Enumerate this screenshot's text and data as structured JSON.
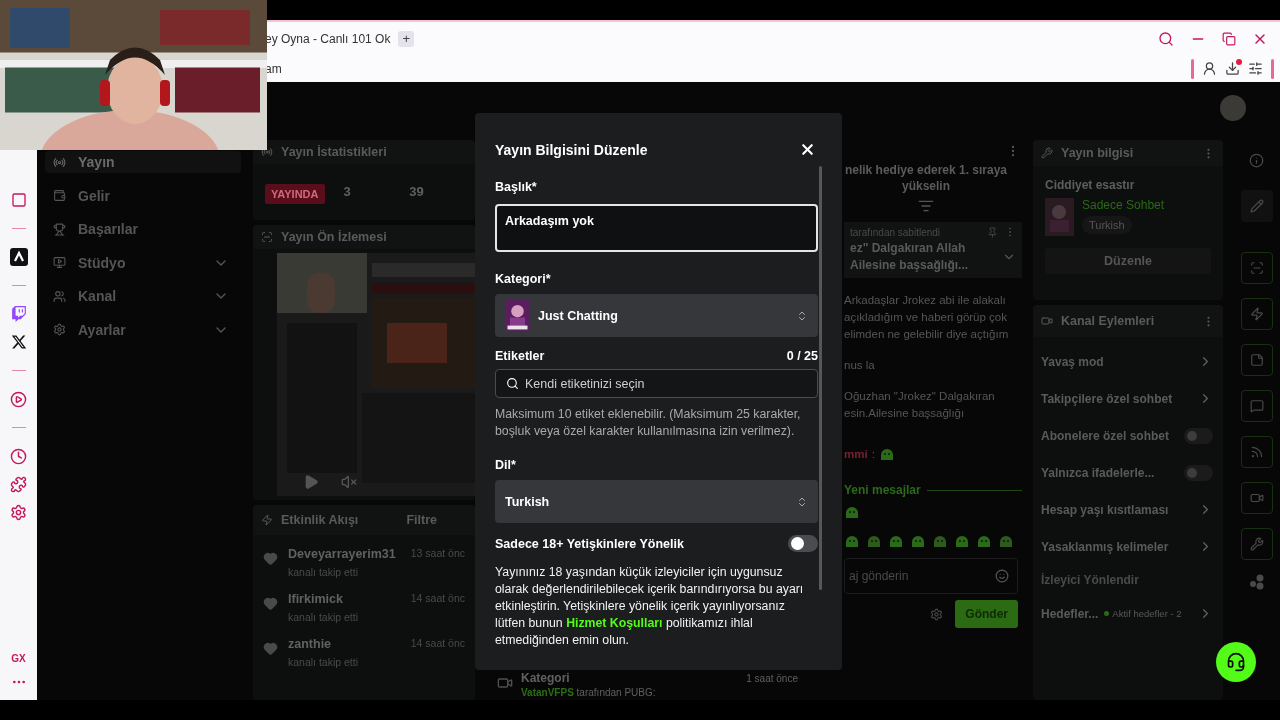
{
  "browser": {
    "tab_title": "ey Oyna - Canlı 101 Ok",
    "new_tab": "+",
    "address": "am",
    "download_alert": true
  },
  "opera_sidebar": {
    "badge": "GX"
  },
  "nav": {
    "items": [
      {
        "label": "Yayın",
        "selected": true,
        "expandable": false
      },
      {
        "label": "Gelir",
        "selected": false,
        "expandable": false
      },
      {
        "label": "Başarılar",
        "selected": false,
        "expandable": false
      },
      {
        "label": "Stüdyo",
        "selected": false,
        "expandable": true
      },
      {
        "label": "Kanal",
        "selected": false,
        "expandable": true
      },
      {
        "label": "Ayarlar",
        "selected": false,
        "expandable": true
      }
    ]
  },
  "stats": {
    "title": "Yayın İstatistikleri",
    "status": "YAYINDA",
    "values": [
      "3",
      "39"
    ]
  },
  "preview": {
    "title": "Yayın Ön İzlemesi"
  },
  "activity": {
    "title": "Etkinlik Akışı",
    "filter": "Filtre",
    "items": [
      {
        "user": "Deveyarrayerim31",
        "action": "kanalı takip etti",
        "time": "13 saat önc"
      },
      {
        "user": "Ifirkimick",
        "action": "kanalı takip etti",
        "time": "14 saat önc"
      },
      {
        "user": "zanthie",
        "action": "kanalı takip etti",
        "time": "14 saat önc"
      }
    ]
  },
  "feed_item": {
    "title": "Kategori",
    "user": "VatanVFPS",
    "text": "tarafından PUBG:",
    "time": "1 saat önce"
  },
  "chat": {
    "banner": [
      "nelik hediye ederek 1. sıraya",
      "yükselin"
    ],
    "pinned": {
      "by": "tarafından sabitlendi",
      "lines": [
        "ez\" Dalgakıran Allah",
        "Ailesine başsağlığı..."
      ]
    },
    "messages": [
      {
        "kind": "text",
        "lines": [
          "Arkadaşlar Jrokez abi ile alakalı",
          "açıkladığım ve haberi görüp çok",
          "elimden ne gelebilir diye açtığım"
        ]
      },
      {
        "kind": "text",
        "lines": [
          "nus la"
        ]
      },
      {
        "kind": "text",
        "lines": [
          "Oğuzhan \"Jrokez\" Dalgakıran",
          "esin.Ailesine başsağlığı"
        ]
      },
      {
        "kind": "emote",
        "user": "mmi",
        "separator": ":"
      }
    ],
    "new_messages": "Yeni mesajlar",
    "input_placeholder": "aj gönderin",
    "send": "Gönder"
  },
  "stream_info": {
    "title": "Yayın bilgisi",
    "stream_title": "Ciddiyet esastır",
    "category": "Sadece Sohbet",
    "language": "Turkish",
    "edit": "Düzenle"
  },
  "channel_actions": {
    "title": "Kanal Eylemleri",
    "items": [
      {
        "kind": "link",
        "label": "Yavaş mod"
      },
      {
        "kind": "link",
        "label": "Takipçilere özel sohbet"
      },
      {
        "kind": "toggle",
        "label": "Abonelere özel sohbet",
        "on": false
      },
      {
        "kind": "toggle",
        "label": "Yalnızca ifadelerle...",
        "on": false
      },
      {
        "kind": "link",
        "label": "Hesap yaşı kısıtlaması"
      },
      {
        "kind": "link",
        "label": "Yasaklanmış kelimeler"
      },
      {
        "kind": "section",
        "label": "İzleyici Yönlendir"
      },
      {
        "kind": "goal",
        "label": "Hedefler...",
        "status": "Aktif hedefler - 2"
      }
    ]
  },
  "modal": {
    "title": "Yayın Bilgisini Düzenle",
    "title_label": "Başlık*",
    "title_value": "Arkadaşım yok",
    "category_label": "Kategori*",
    "category": "Just Chatting",
    "tags_label": "Etiketler",
    "tags_count": "0 / 25",
    "tags_placeholder": "Kendi etiketinizi seçin",
    "tags_hint": "Maksimum 10 etiket eklenebilir. (Maksimum 25 karakter, boşluk veya özel karakter kullanılmasına izin verilmez).",
    "language_label": "Dil*",
    "language": "Turkish",
    "mature": {
      "label": "Sadece 18+ Yetişkinlere Yönelik",
      "on": false
    },
    "mature_text": "Yayınınız 18 yaşından küçük izleyiciler için uygunsuz olarak değerlendirilebilecek içerik barındırıyorsa bu ayarı etkinleştirin. Yetişkinlere yönelik içerik yayınlıyorsanız lütfen bunun ",
    "mature_link": "Hizmet Koşulları",
    "mature_text_end": " politikamızı ihlal etmediğinden emin olun."
  }
}
